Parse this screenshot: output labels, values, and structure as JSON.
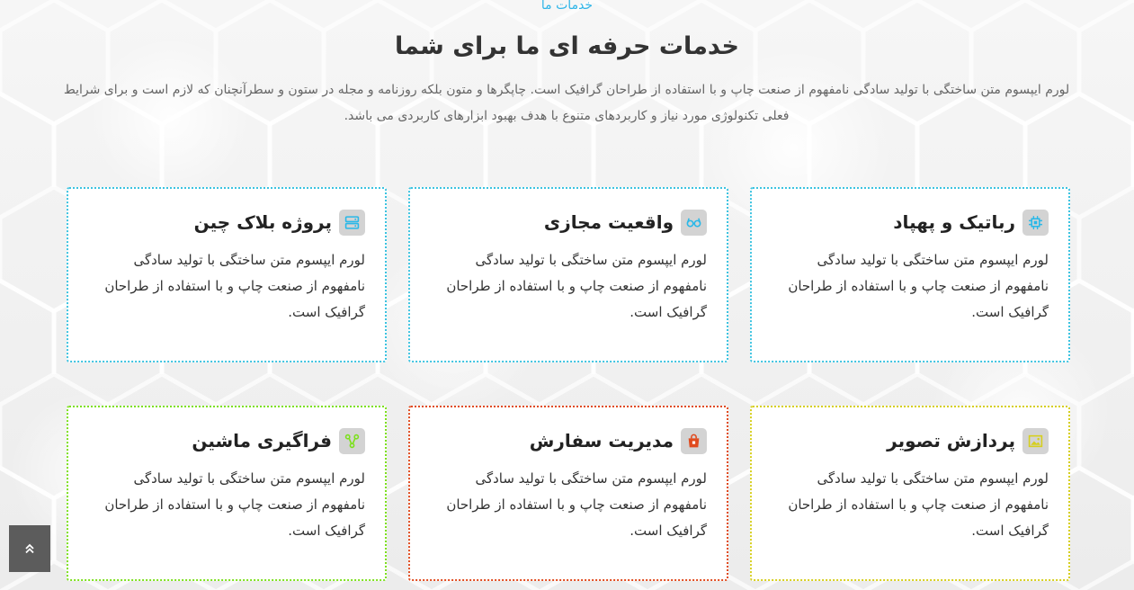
{
  "section": {
    "kicker": "خدمات ما",
    "title": "خدمات حرفه ای ما برای شما",
    "description": "لورم ایپسوم متن ساختگی با تولید سادگی نامفهوم از صنعت چاپ و با استفاده از طراحان گرافیک است. چاپگرها و متون بلکه روزنامه و مجله در ستون و سطرآنچنان که لازم است و برای شرایط فعلی تکنولوژی مورد نیاز و کاربردهای متنوع با هدف بهبود ابزارهای کاربردی می باشد."
  },
  "services": [
    {
      "title": "رباتیک و پهپاد",
      "text": "لورم ایپسوم متن ساختگی با تولید سادگی نامفهوم از صنعت چاپ و با استفاده از طراحان گرافیک است.",
      "icon": "chip-icon",
      "color": "#3cc3e0"
    },
    {
      "title": "واقعیت مجازی",
      "text": "لورم ایپسوم متن ساختگی با تولید سادگی نامفهوم از صنعت چاپ و با استفاده از طراحان گرافیک است.",
      "icon": "vr-glasses-icon",
      "color": "#3cc3e0"
    },
    {
      "title": "پروژه بلاک چین",
      "text": "لورم ایپسوم متن ساختگی با تولید سادگی نامفهوم از صنعت چاپ و با استفاده از طراحان گرافیک است.",
      "icon": "server-icon",
      "color": "#3cc3e0"
    },
    {
      "title": "پردازش تصویر",
      "text": "لورم ایپسوم متن ساختگی با تولید سادگی نامفهوم از صنعت چاپ و با استفاده از طراحان گرافیک است.",
      "icon": "image-icon",
      "color": "#d6cf1e"
    },
    {
      "title": "مدیریت سفارش",
      "text": "لورم ایپسوم متن ساختگی با تولید سادگی نامفهوم از صنعت چاپ و با استفاده از طراحان گرافیک است.",
      "icon": "shopping-bag-icon",
      "color": "#e04b1f"
    },
    {
      "title": "فراگیری ماشین",
      "text": "لورم ایپسوم متن ساختگی با تولید سادگی نامفهوم از صنعت چاپ و با استفاده از طراحان گرافیک است.",
      "icon": "branch-icon",
      "color": "#7de01e"
    }
  ],
  "scroll_top": {
    "icon": "double-chevron-up-icon"
  }
}
